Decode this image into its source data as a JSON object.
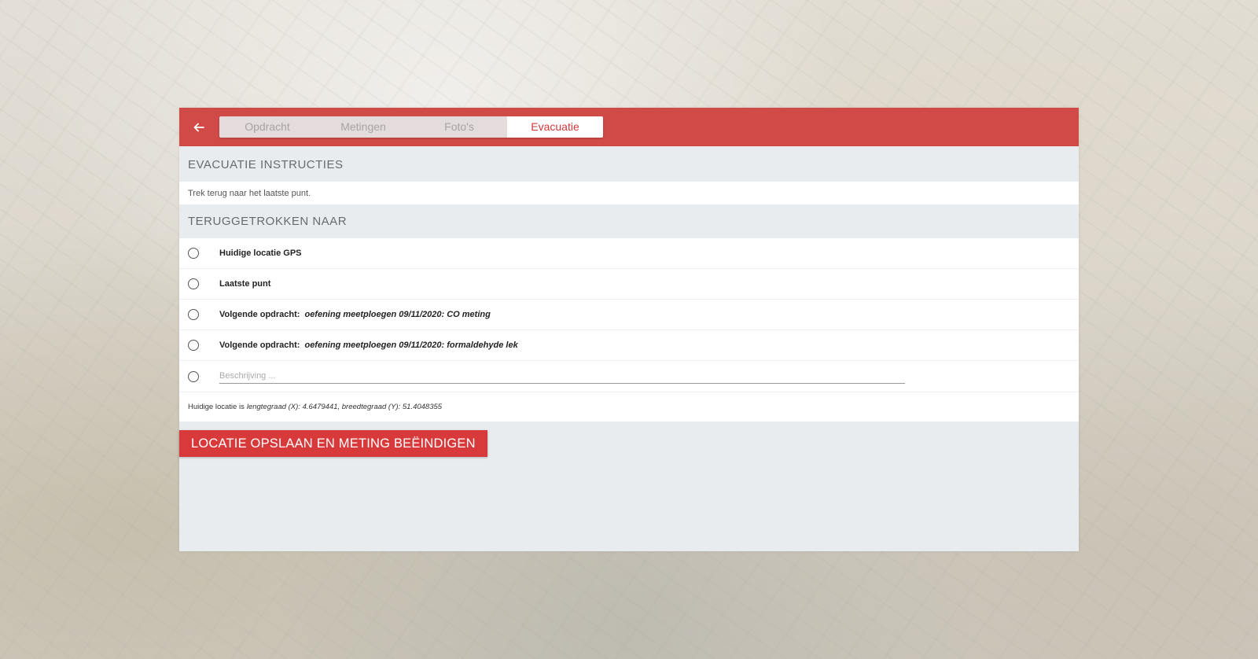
{
  "colors": {
    "topbar": "#d04a48",
    "accent": "#d0383a",
    "button": "#d8393a",
    "panel_background": "#e9ecef"
  },
  "header": {
    "back_icon": "arrow-left-icon",
    "tabs": [
      {
        "label": "Opdracht",
        "active": false
      },
      {
        "label": "Metingen",
        "active": false
      },
      {
        "label": "Foto's",
        "active": false
      },
      {
        "label": "Evacuatie",
        "active": true
      }
    ]
  },
  "instructions": {
    "title": "EVACUATIE INSTRUCTIES",
    "text": "Trek terug naar het laatste punt."
  },
  "retreat": {
    "title": "TERUGGETROKKEN NAAR",
    "options": [
      {
        "label": "Huidige locatie GPS",
        "detail": ""
      },
      {
        "label": "Laatste punt",
        "detail": ""
      },
      {
        "label": "Volgende opdracht:",
        "detail": "oefening meetploegen 09/11/2020: CO meting"
      },
      {
        "label": "Volgende opdracht:",
        "detail": "oefening meetploegen 09/11/2020: formaldehyde lek"
      }
    ],
    "description_placeholder": "Beschrijving ..."
  },
  "location": {
    "prefix": "Huidige locatie is",
    "coords": "lengtegraad (X): 4.6479441, breedtegraad (Y): 51.4048355"
  },
  "actions": {
    "save_label": "LOCATIE OPSLAAN EN METING BEËINDIGEN"
  }
}
